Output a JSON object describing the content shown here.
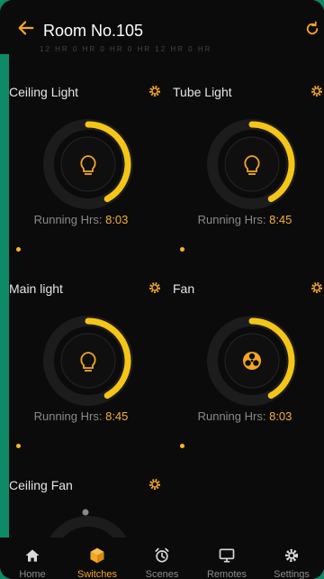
{
  "header": {
    "title": "Room No.105",
    "back_icon": "arrow-left-icon",
    "refresh_icon": "refresh-icon",
    "faded_row": "12 HR   0 HR   0 HR   0 HR   12 HR        0 HR"
  },
  "cards": [
    {
      "title": "Ceiling Light",
      "running_label": "Running Hrs:",
      "running_value": "8:03",
      "icon": "lightbulb-icon",
      "level": 0.42
    },
    {
      "title": "Tube Light",
      "running_label": "Running Hrs:",
      "running_value": "8:45",
      "icon": "lightbulb-icon",
      "level": 0.42
    },
    {
      "title": "Main light",
      "running_label": "Running Hrs:",
      "running_value": "8:45",
      "icon": "lightbulb-icon",
      "level": 0.42
    },
    {
      "title": "Fan",
      "running_label": "Running Hrs:",
      "running_value": "8:03",
      "icon": "fan-icon",
      "level": 0.42
    },
    {
      "title": "Ceiling Fan",
      "icon": "fan-icon"
    }
  ],
  "nav": [
    {
      "label": "Home",
      "icon": "home-icon",
      "active": false
    },
    {
      "label": "Switches",
      "icon": "cube-icon",
      "active": true
    },
    {
      "label": "Scenes",
      "icon": "alarm-clock-icon",
      "active": false
    },
    {
      "label": "Remotes",
      "icon": "monitor-icon",
      "active": false
    },
    {
      "label": "Settings",
      "icon": "gear-icon",
      "active": false
    }
  ],
  "colors": {
    "accent": "#f5b81f",
    "active_nav": "#f5a623",
    "background": "#0b0b0b",
    "frame": "#0f8a66"
  }
}
